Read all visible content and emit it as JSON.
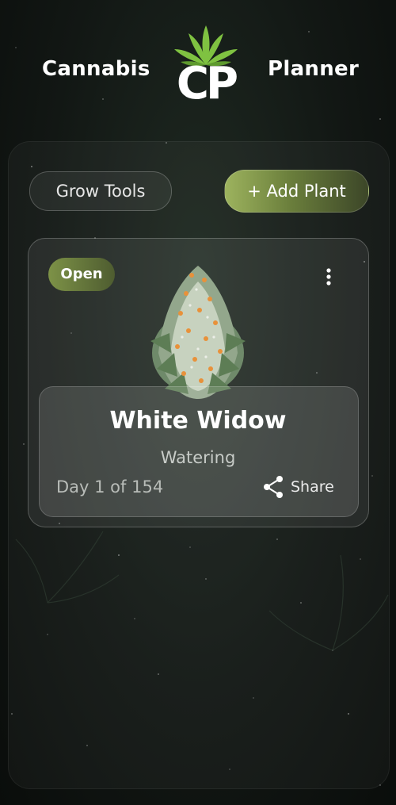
{
  "header": {
    "left_word": "Cannabis",
    "logo_text": "CP",
    "right_word": "Planner"
  },
  "toolbar": {
    "grow_tools_label": "Grow Tools",
    "add_plant_label": "+ Add Plant"
  },
  "plant_card": {
    "status_badge": "Open",
    "strain_name": "White Widow",
    "stage": "Watering",
    "day_progress": "Day 1 of 154",
    "share_label": "Share",
    "menu_icon": "more-vertical-icon",
    "image": "cannabis-bud-illustration"
  },
  "colors": {
    "accent_green": "#8aa04e",
    "leaf_green": "#7fc241",
    "background": "#121714"
  }
}
